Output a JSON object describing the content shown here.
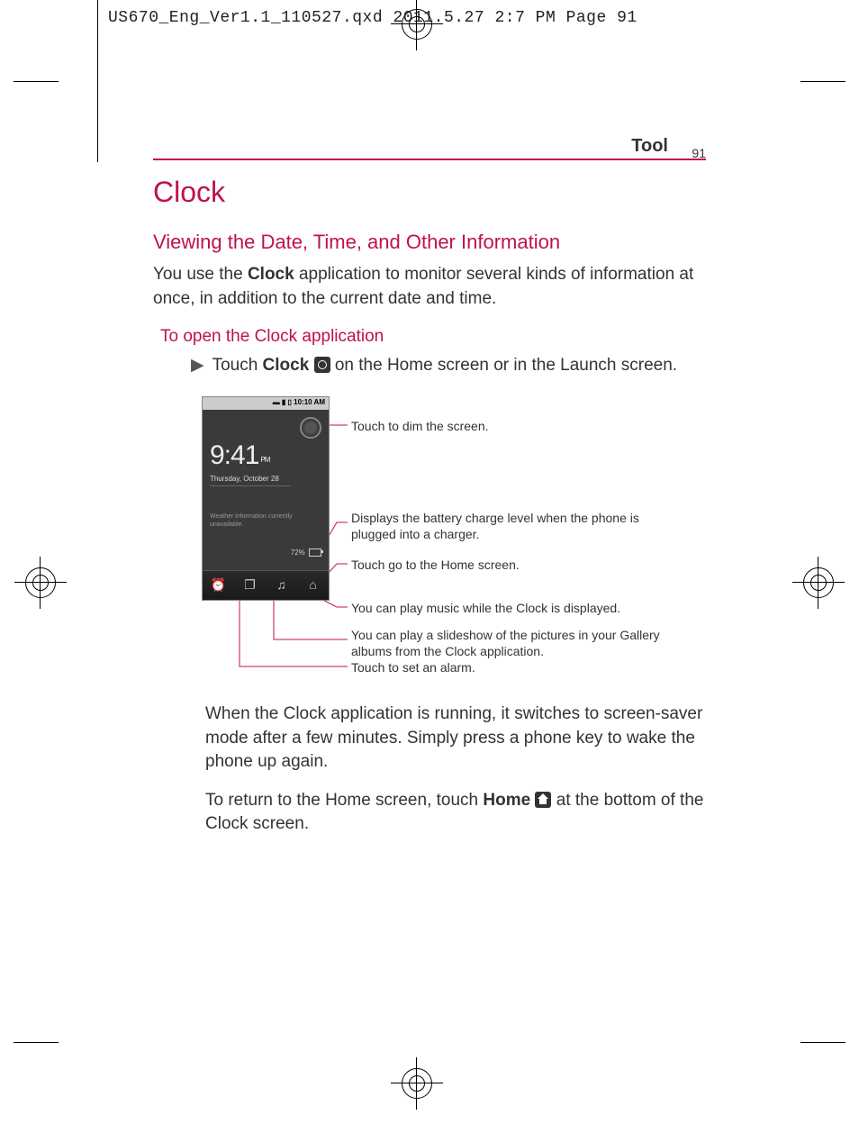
{
  "header": {
    "slug": "US670_Eng_Ver1.1_110527.qxd  2011.5.27  2:7 PM  Page 91"
  },
  "section": {
    "label": "Tool",
    "page_no": "91"
  },
  "title": "Clock",
  "subtitle": "Viewing the Date, Time, and Other Information",
  "intro_a": "You use the ",
  "intro_bold": "Clock",
  "intro_b": " application to monitor several kinds of information at once, in addition to the current date and time.",
  "step_heading": "To open the Clock application",
  "bullet": {
    "a": "Touch ",
    "bold": "Clock",
    "b": " on the Home screen or in the Launch screen."
  },
  "phone": {
    "status_time": "10:10 AM",
    "time": "9:41",
    "ampm": "PM",
    "date": "Thursday, October 28",
    "weather": "Weather information currently unavailable.",
    "battery": "72%"
  },
  "callouts": {
    "dim": "Touch to dim the screen.",
    "battery": "Displays the battery charge level when the phone is plugged into a charger.",
    "home": "Touch go to the Home screen.",
    "music": "You can play music while the Clock is displayed.",
    "slideshow": "You can play a slideshow of the pictures in your Gallery albums from the Clock application.",
    "alarm": "Touch to set an alarm."
  },
  "para1": "When the Clock application is running, it switches to screen-saver mode after a few minutes. Simply press a phone key to wake the phone up again.",
  "para2a": "To return to the Home screen, touch ",
  "para2bold": "Home",
  "para2b": " at the bottom of the Clock screen."
}
